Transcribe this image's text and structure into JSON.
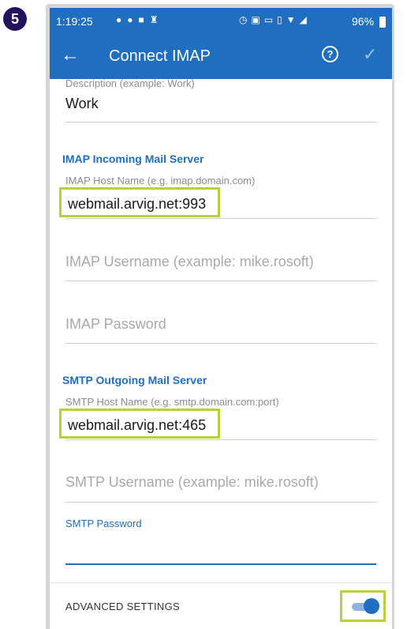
{
  "step": {
    "number": "5"
  },
  "status_bar": {
    "time": "1:19:25",
    "left_icons": [
      "facebook-icon",
      "facebook-icon",
      "youtube-icon",
      "trophy-icon"
    ],
    "right_icons": [
      "alarm-icon",
      "nfc-icon",
      "volte-icon",
      "vibrate-icon",
      "wifi-icon",
      "signal-icon"
    ],
    "battery_percent": "96%"
  },
  "app_bar": {
    "title": "Connect IMAP",
    "help_label": "?"
  },
  "form": {
    "description": {
      "label": "Description (example: Work)",
      "value": "Work"
    },
    "imap_section": {
      "header": "IMAP Incoming Mail Server"
    },
    "imap_host": {
      "label": "IMAP Host Name (e.g. imap.domain.com)",
      "value": "webmail.arvig.net:993"
    },
    "imap_username": {
      "placeholder": "IMAP Username (example: mike.rosoft)"
    },
    "imap_password": {
      "placeholder": "IMAP Password"
    },
    "smtp_section": {
      "header": "SMTP Outgoing Mail Server"
    },
    "smtp_host": {
      "label": "SMTP Host Name (e.g. smtp.domain.com:port)",
      "value": "webmail.arvig.net:465"
    },
    "smtp_username": {
      "placeholder": "SMTP Username (example: mike.rosoft)"
    },
    "smtp_password": {
      "label": "SMTP Password",
      "value": ""
    }
  },
  "advanced_settings": {
    "label": "ADVANCED SETTINGS",
    "enabled": true
  },
  "colors": {
    "accent": "#1f6ec0",
    "highlight": "#b9d03a",
    "badge": "#23135a"
  }
}
